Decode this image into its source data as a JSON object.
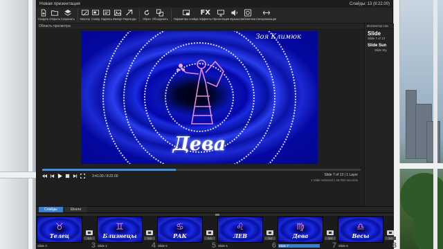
{
  "app": {
    "title": "Новая презентация",
    "slides_status": "Слайды: 13 (8:22.00)"
  },
  "toolbar": [
    {
      "label": "Создать",
      "icon": "new-file-icon"
    },
    {
      "label": "Открыть",
      "icon": "open-folder-icon"
    },
    {
      "label": "Сохранить",
      "icon": "save-icon"
    },
    {
      "label": "Мастер",
      "icon": "wizard-icon"
    },
    {
      "label": "Слайд",
      "icon": "slide-icon"
    },
    {
      "label": "Надпись",
      "icon": "caption-icon"
    },
    {
      "label": "Импорт",
      "icon": "import-icon"
    },
    {
      "label": "Переходы",
      "icon": "transitions-icon"
    },
    {
      "label": "Обрез",
      "icon": "rotate-icon"
    },
    {
      "label": "Объединить",
      "icon": "merge-icon"
    },
    {
      "label": "Параметры слайда",
      "icon": "slide-options-icon"
    },
    {
      "label": "Эффекты",
      "icon": "fx-icon"
    },
    {
      "label": "Презентация",
      "icon": "presentation-icon"
    },
    {
      "label": "Музыка",
      "icon": "music-icon"
    },
    {
      "label": "Библиотека",
      "icon": "library-icon"
    },
    {
      "label": "Синхронизация",
      "icon": "sync-icon"
    }
  ],
  "preview": {
    "header": "Область просмотра",
    "slide_author": "Зоя Климюк",
    "slide_title": "Дева",
    "progress": 0.42,
    "timecode": "3:41.00 / 8:22.00",
    "slide_info": "Slide 7 of 13  |  1 Layer",
    "slide_info_sub": "1 Slide Selected  |  46.000 seconds"
  },
  "inspector": {
    "header": "Инспектор сла",
    "title": "Slide",
    "subtitle": "Slide 7 of 13",
    "section_title": "Slide Sun",
    "section_sub": "Slide Sty"
  },
  "strip": {
    "tabs": [
      "Слайды",
      "Шкала"
    ],
    "active_tab": 0,
    "slides": [
      {
        "caption": "Slide 3",
        "number": "3",
        "title": "Телец",
        "glyph": "♉",
        "duration": "3.0",
        "selected": false
      },
      {
        "caption": "Slide 4",
        "number": "4",
        "title": "Близнецы",
        "glyph": "♊",
        "duration": "3.0",
        "selected": false
      },
      {
        "caption": "Slide 5",
        "number": "5",
        "title": "РАК",
        "glyph": "♋",
        "duration": "3.0",
        "selected": false
      },
      {
        "caption": "Slide 6",
        "number": "6",
        "title": "ЛЕВ",
        "glyph": "♌",
        "duration": "3.0",
        "selected": false
      },
      {
        "caption": "Slide 7",
        "number": "7",
        "title": "Дева",
        "glyph": "♍",
        "duration": "3.0",
        "selected": true
      },
      {
        "caption": "Slide 8",
        "number": "8",
        "title": "Весы",
        "glyph": "♎",
        "duration": "3.0",
        "selected": false
      }
    ]
  },
  "colors": {
    "accent": "#3b7fd0",
    "slide_blue": "#0a14b8",
    "figure_pink": "#e58ad8"
  }
}
